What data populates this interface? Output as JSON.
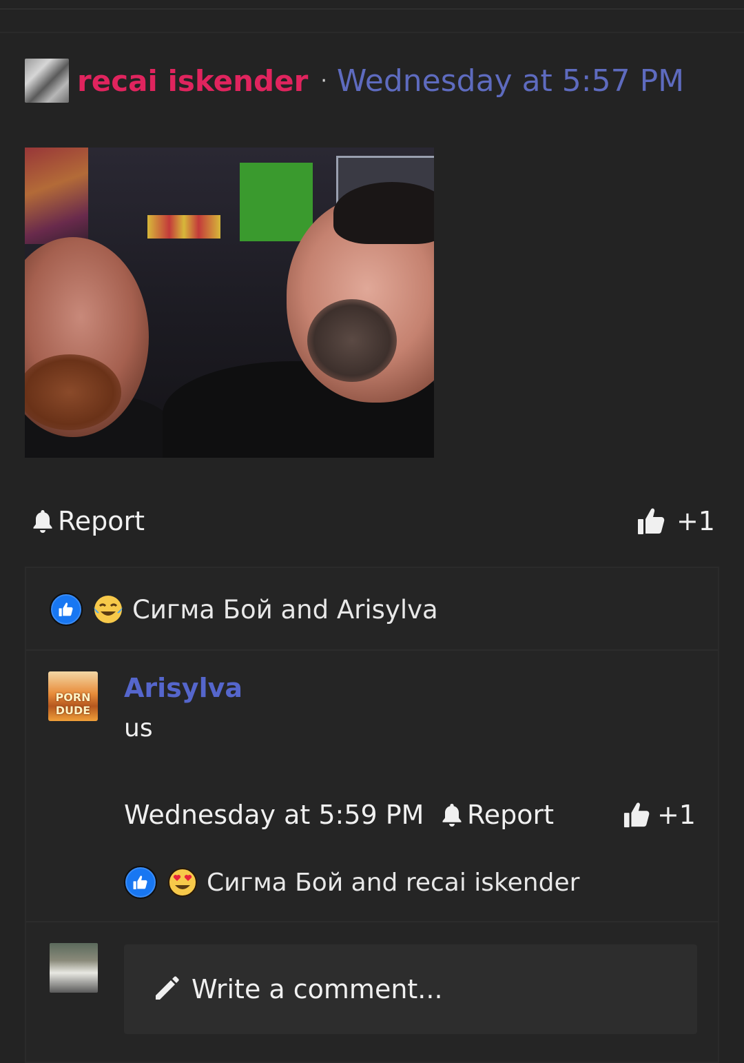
{
  "post": {
    "author": "recai iskender",
    "separator": "·",
    "timestamp": "Wednesday at 5:57 PM",
    "actions": {
      "report_label": "Report",
      "like_count": "+1"
    },
    "reactions_text": "Сигма Бой and Arisylva",
    "reaction_icons": [
      "like-icon",
      "crying-laughing-emoji-icon"
    ]
  },
  "comment": {
    "author": "Arisylva",
    "avatar_text": "PORN DUDE",
    "body": "us",
    "timestamp": "Wednesday at 5:59 PM",
    "report_label": "Report",
    "like_count": "+1",
    "reactions_text": "Сигма Бой and recai iskender",
    "reaction_icons": [
      "like-icon",
      "heart-eyes-emoji-icon"
    ]
  },
  "composer": {
    "placeholder": "Write a comment..."
  },
  "colors": {
    "background": "#232323",
    "author_accent": "#e0245e",
    "link_blue": "#5e6bbf",
    "like_blue": "#1877f2"
  }
}
